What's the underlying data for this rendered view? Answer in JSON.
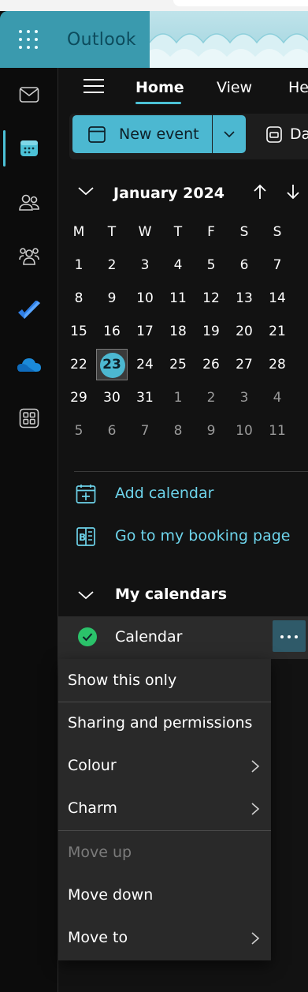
{
  "app": {
    "name": "Outlook"
  },
  "nav": {
    "tabs": [
      {
        "label": "Home"
      },
      {
        "label": "View"
      },
      {
        "label": "He"
      }
    ]
  },
  "toolbar": {
    "new_event_label": "New event",
    "day_label": "Da"
  },
  "calendar": {
    "month_title": "January 2024",
    "weekdays": [
      "M",
      "T",
      "W",
      "T",
      "F",
      "S",
      "S"
    ],
    "weeks": [
      [
        "1",
        "2",
        "3",
        "4",
        "5",
        "6",
        "7"
      ],
      [
        "8",
        "9",
        "10",
        "11",
        "12",
        "13",
        "14"
      ],
      [
        "15",
        "16",
        "17",
        "18",
        "19",
        "20",
        "21"
      ],
      [
        "22",
        "23",
        "24",
        "25",
        "26",
        "27",
        "28"
      ],
      [
        "29",
        "30",
        "31",
        "1",
        "2",
        "3",
        "4"
      ],
      [
        "5",
        "6",
        "7",
        "8",
        "9",
        "10",
        "11"
      ]
    ],
    "today": "23"
  },
  "links": {
    "add_calendar": "Add calendar",
    "booking_page": "Go to my booking page"
  },
  "my_calendars": {
    "section_label": "My calendars",
    "items": [
      {
        "label": "Calendar"
      }
    ]
  },
  "context_menu": {
    "items": [
      {
        "label": "Show this only"
      },
      {
        "label": "Sharing and permissions"
      },
      {
        "label": "Colour"
      },
      {
        "label": "Charm"
      },
      {
        "label": "Move up"
      },
      {
        "label": "Move down"
      },
      {
        "label": "Move to"
      }
    ]
  },
  "colors": {
    "accent": "#4cb8d1",
    "link": "#6dd3ea",
    "check": "#2bc26a",
    "header": "#3c9fb3"
  }
}
